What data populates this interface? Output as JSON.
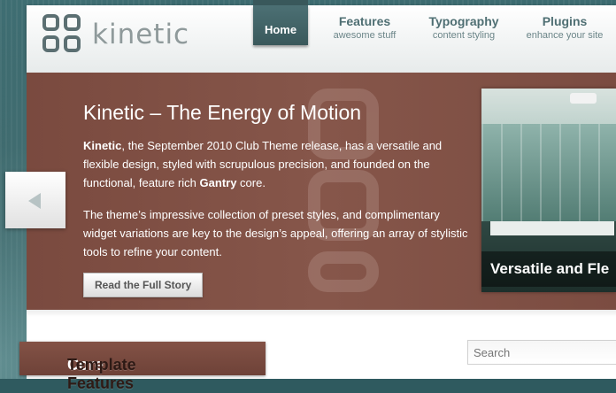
{
  "brand": {
    "name": "kinetic"
  },
  "nav": [
    {
      "title": "Home",
      "subtitle": ""
    },
    {
      "title": "Features",
      "subtitle": "awesome stuff"
    },
    {
      "title": "Typography",
      "subtitle": "content styling"
    },
    {
      "title": "Plugins",
      "subtitle": "enhance your site"
    }
  ],
  "showcase": {
    "title": "Kinetic – The Energy of Motion",
    "p1_lead": "Kinetic",
    "p1_mid": ", the September 2010 Club Theme release, has a versatile and flexible design, styled with scrupulous precision, and founded on the functional, feature rich ",
    "p1_strong": "Gantry",
    "p1_end": " core.",
    "p2": "The theme’s impressive collection of preset styles, and complimentary widget variations are key to the design’s appeal, offering an array of stylistic tools to refine your content.",
    "button": "Read the Full Story",
    "image_caption": "Versatile and Fle"
  },
  "module": {
    "title_first": "Core",
    "title_rest": " Template Features"
  },
  "search": {
    "placeholder": "Search"
  },
  "colors": {
    "accent": "#39585b",
    "panel": "#7f4f44"
  }
}
